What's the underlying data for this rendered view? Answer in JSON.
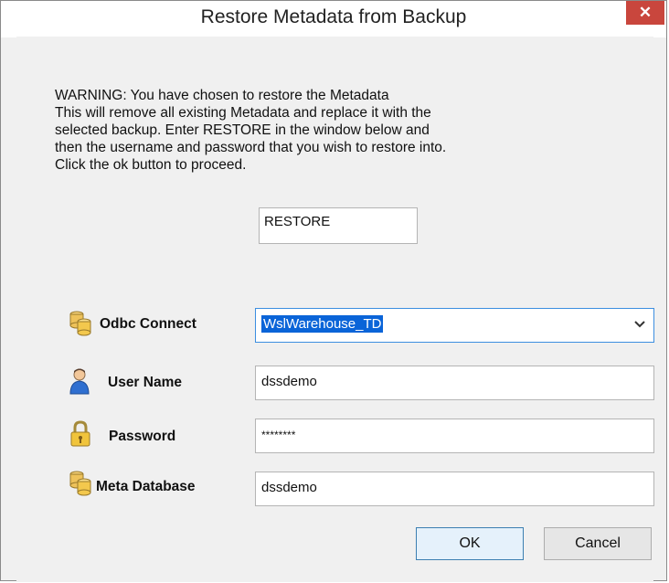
{
  "window": {
    "title": "Restore Metadata from Backup",
    "close_glyph": "✕"
  },
  "warning": {
    "lines": [
      "WARNING: You have chosen to restore the Metadata",
      "This will remove all existing Metadata and replace it with the",
      "selected backup. Enter RESTORE in the window below and",
      "then the username and password that you wish to restore into.",
      "Click the ok button to proceed."
    ]
  },
  "restore_input": {
    "value": "RESTORE"
  },
  "form": {
    "odbc": {
      "label": "Odbc Connect",
      "value": "WslWarehouse_TD",
      "icon": "database-icon"
    },
    "user": {
      "label": "User Name",
      "value": "dssdemo",
      "icon": "user-icon"
    },
    "password": {
      "label": "Password",
      "value": "********",
      "icon": "lock-icon"
    },
    "meta": {
      "label": "Meta Database",
      "value": "dssdemo",
      "icon": "database-icon"
    }
  },
  "buttons": {
    "ok": "OK",
    "cancel": "Cancel"
  },
  "colors": {
    "close_red": "#c9463d",
    "selection_blue": "#0a64d8",
    "dialog_bg": "#f0f0f0"
  }
}
